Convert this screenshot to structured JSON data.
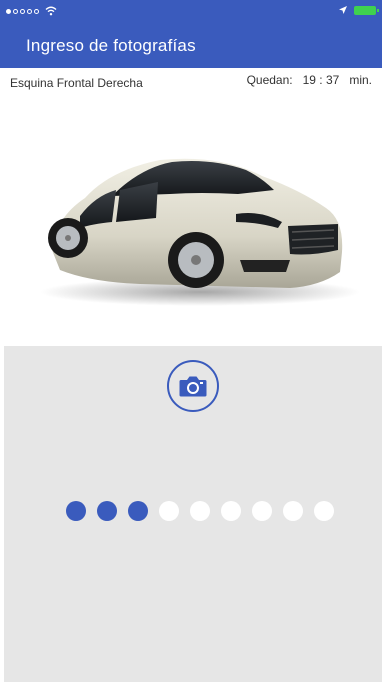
{
  "status_bar": {
    "signal_icon": "signal-dots-icon",
    "wifi_icon": "wifi-icon",
    "location_icon": "location-arrow-icon",
    "battery_icon": "battery-icon"
  },
  "header": {
    "title": "Ingreso de fotografías"
  },
  "info": {
    "angle_label": "Esquina Frontal Derecha",
    "remaining_label": "Quedan:",
    "time": "19 : 37",
    "unit": "min."
  },
  "car": {
    "image": "car-front-right-photo"
  },
  "capture": {
    "camera_icon": "camera-icon"
  },
  "progress": {
    "completed": 3,
    "total": 9
  },
  "colors": {
    "primary": "#3a5bbd",
    "panel": "#e6e6e6",
    "dot_pending": "#ffffff"
  }
}
